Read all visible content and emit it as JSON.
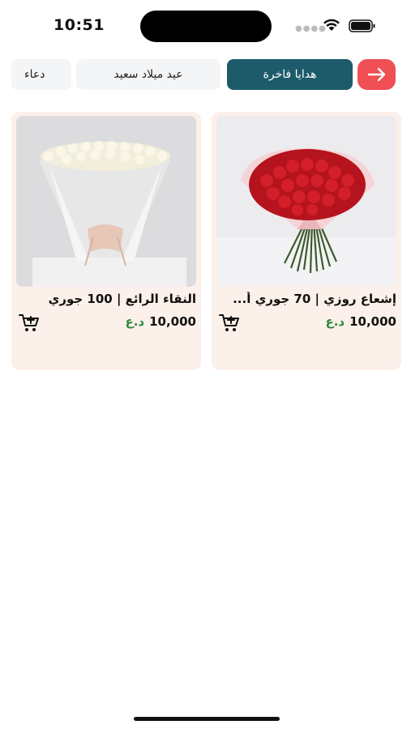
{
  "status_bar": {
    "time": "10:51"
  },
  "categories": {
    "back_icon": "arrow-right-icon",
    "items": [
      {
        "label": "هدايا فاخرة",
        "active": true
      },
      {
        "label": "عيد ميلاد سعيد",
        "active": false
      },
      {
        "label": "دعاء",
        "active": false
      }
    ]
  },
  "products": [
    {
      "title": "إشعاع روزي | 70 جوري أ...",
      "price": "10,000",
      "currency": "د.ع",
      "image": "red-roses-bouquet"
    },
    {
      "title": "النقاء الرائع | 100 جوري",
      "price": "10,000",
      "currency": "د.ع",
      "image": "white-roses-bouquet"
    }
  ],
  "colors": {
    "accent": "#1e5b6a",
    "back_button": "#ef4f55",
    "card_bg": "#fcf0ea",
    "currency": "#2c8a3c"
  }
}
